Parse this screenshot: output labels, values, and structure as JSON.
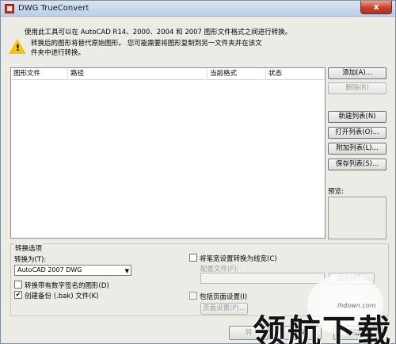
{
  "window": {
    "title": "DWG TrueConvert",
    "close_label": "x"
  },
  "info": {
    "line": "使用此工具可以在 AutoCAD R14、2000、2004 和 2007 图形文件格式之间进行转换。",
    "warning_line1": "转换后的图形将替代原始图形。 您可能需要将图形复制到另一文件夹并在该文",
    "warning_line2": "件夹中进行转换。",
    "warning_mark": "!"
  },
  "list": {
    "columns": [
      "图形文件",
      "路径",
      "当前格式",
      "状态"
    ]
  },
  "buttons": {
    "add": "添加(A)...",
    "remove": "删除(R)",
    "new_list": "新建列表(N)",
    "open_list": "打开列表(O)...",
    "append_list": "附加列表(L)...",
    "save_list": "保存列表(S)..."
  },
  "preview": {
    "label": "预览:"
  },
  "options": {
    "group_title": "转换选项",
    "convert_to_label": "转换为(T):",
    "convert_to_value": "AutoCAD 2007 DWG",
    "digital_sig_label": "转换带有数字签名的图形(D)",
    "digital_sig_checked": false,
    "backup_label": "创建备份 (.bak) 文件(K)",
    "backup_checked": true,
    "lineweight_label": "将笔宽设置转换为线宽(C)",
    "lineweight_checked": false,
    "config_file_label": "配置文件(F):",
    "browse_label": "浏览(B)...",
    "page_setup_label": "包括页面设置(I)",
    "page_setup_checked": false,
    "page_setup_btn": "页面设置(P)..."
  },
  "footer": {
    "convert": "转",
    "cancel": "取",
    "help": "帮助(H)"
  },
  "watermark": {
    "text": "领航下载",
    "url": "lhdown.com"
  },
  "colors": {
    "titlebar": "#bccfe6",
    "close": "#c5412c",
    "warning": "#f0c419"
  }
}
